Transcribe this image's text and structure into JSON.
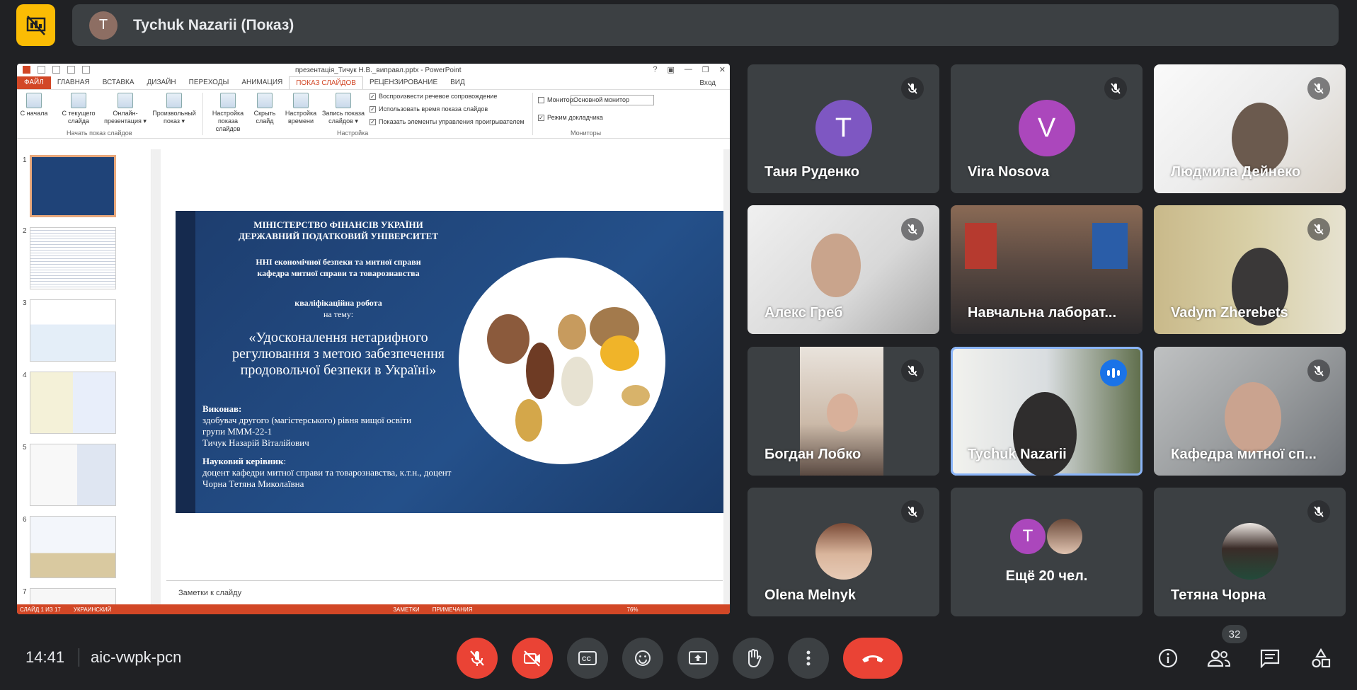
{
  "presenter": {
    "initial": "T",
    "name": "Tychuk Nazarii (Показ)"
  },
  "ppt": {
    "window_title": "презентація_Тичук Н.В._виправл.pptx - PowerPoint",
    "window_controls": [
      "?",
      "▣",
      "—",
      "❐",
      "✕"
    ],
    "tabs": [
      "ФАЙЛ",
      "ГЛАВНАЯ",
      "ВСТАВКА",
      "ДИЗАЙН",
      "ПЕРЕХОДЫ",
      "АНИМАЦИЯ",
      "ПОКАЗ СЛАЙДОВ",
      "РЕЦЕНЗИРОВАНИЕ",
      "ВИД"
    ],
    "login": "Вход",
    "ribbon": {
      "btn_from_start": "С начала",
      "btn_from_current": "С текущего слайда",
      "btn_online": "Онлайн-презентация ▾",
      "btn_custom": "Произвольный показ ▾",
      "group_start": "Начать показ слайдов",
      "btn_setup": "Настройка показа слайдов",
      "btn_hide": "Скрыть слайд",
      "btn_timing": "Настройка времени",
      "btn_record": "Запись показа слайдов ▾",
      "check_narration": "Воспроизвести речевое сопровождение",
      "check_timings": "Использовать время показа слайдов",
      "check_controls": "Показать элементы управления проигрывателем",
      "group_setup": "Настройка",
      "monitor_label": "Монитор:",
      "monitor_value": "Основной монитор",
      "presenter_view": "Режим докладчика",
      "group_monitors": "Мониторы"
    },
    "thumb_numbers": [
      "1",
      "2",
      "3",
      "4",
      "5",
      "6",
      "7"
    ],
    "slide": {
      "ministry1": "МІНІСТЕРСТВО ФІНАНСІВ УКРАЇНИ",
      "ministry2": "ДЕРЖАВНИЙ ПОДАТКОВИЙ УНІВЕРСИТЕТ",
      "inst1": "ННІ економічної безпеки та митної справи",
      "inst2": "кафедра митної справи та товарознавства",
      "work": "кваліфікаційна робота",
      "topic": "на тему:",
      "title1": "«Удосконалення нетарифного",
      "title2": "регулювання з метою забезпечення",
      "title3": "продовольчої безпеки в Україні»",
      "done_by": "Виконав:",
      "student1": "здобувач другого (магістерського) рівня вищої освіти",
      "student2": "групи МММ-22-1",
      "student3": "Тичук Назарій Віталійович",
      "supervisor": "Науковий керівник",
      "supervisor_colon": ":",
      "sup1": "доцент кафедри митної справи та товарознавства, к.т.н., доцент",
      "sup2": "Чорна Тетяна Миколаївна"
    },
    "notes_placeholder": "Заметки к слайду",
    "status": {
      "slide": "СЛАЙД 1 ИЗ 17",
      "lang": "УКРАИНСКИЙ",
      "notes": "ЗАМЕТКИ",
      "comments": "ПРИМЕЧАНИЯ",
      "zoom": "76%"
    }
  },
  "participants": [
    {
      "name": "Таня Руденко",
      "initial": "T",
      "color": "#7e57c2"
    },
    {
      "name": "Vira Nosova",
      "initial": "V",
      "color": "#ab47bc"
    },
    {
      "name": "Людмила Дейнеко"
    },
    {
      "name": "Алекс Греб"
    },
    {
      "name": "Навчальна лаборат..."
    },
    {
      "name": "Vadym Zherebets"
    },
    {
      "name": "Богдан Лобко"
    },
    {
      "name": "Tychuk Nazarii"
    },
    {
      "name": "Кафедра митної сп..."
    },
    {
      "name": "Olena Melnyk"
    },
    {
      "name": "Ещё 20 чел.",
      "initial": "T"
    },
    {
      "name": "Тетяна Чорна"
    }
  ],
  "bottom": {
    "time": "14:41",
    "meeting_code": "aic-vwpk-pcn",
    "participant_count": "32"
  },
  "colors": {
    "accent": "#fbbc04",
    "danger": "#ea4335",
    "ppt": "#d24726",
    "speaking": "#1a73e8"
  }
}
